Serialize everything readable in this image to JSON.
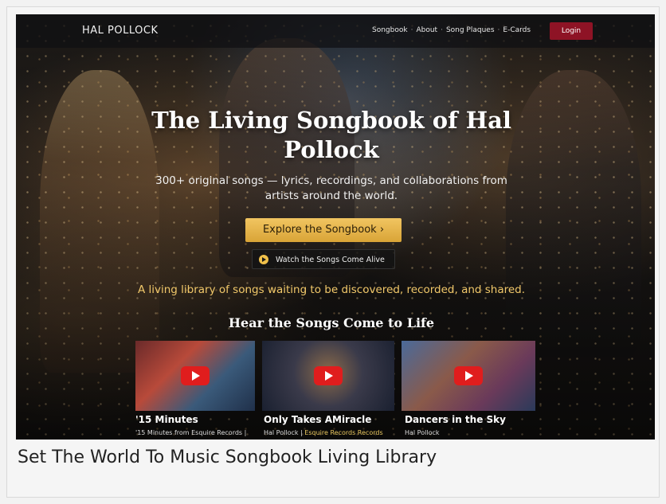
{
  "nav": {
    "brand": "HAL POLLOCK",
    "links": [
      "Songbook",
      "About",
      "Song Plaques",
      "E-Cards"
    ],
    "separator": "·",
    "login": "Login"
  },
  "hero": {
    "title": "The Living Songbook of Hal Pollock",
    "subtitle": "300+ original songs — lyrics, recordings, and collaborations from artists around the world.",
    "explore_label": "Explore the Songbook  ›",
    "watch_label": "Watch the Songs Come Alive",
    "tagline": "A living library of songs waiting to be discovered, recorded, and shared."
  },
  "section": {
    "title": "Hear the Songs Come to Life"
  },
  "videos": [
    {
      "title": "'15 Minutes",
      "sub": "'15 Minutes  from Esquire Records |",
      "highlight": ""
    },
    {
      "title": "Only Takes AMiracle",
      "sub": "Hal Pollock | ",
      "highlight": "Esquire Records Records"
    },
    {
      "title": "Dancers in the Sky",
      "sub": "Hal Pollock",
      "highlight": ""
    }
  ],
  "caption": "Set The World To Music Songbook Living Library",
  "colors": {
    "login_bg": "#8e1325",
    "explore_bg": "#e2b04a",
    "tagline": "#f1c86a",
    "youtube_red": "#e01d1d"
  },
  "icons": [
    "play-icon",
    "youtube-play-icon"
  ]
}
